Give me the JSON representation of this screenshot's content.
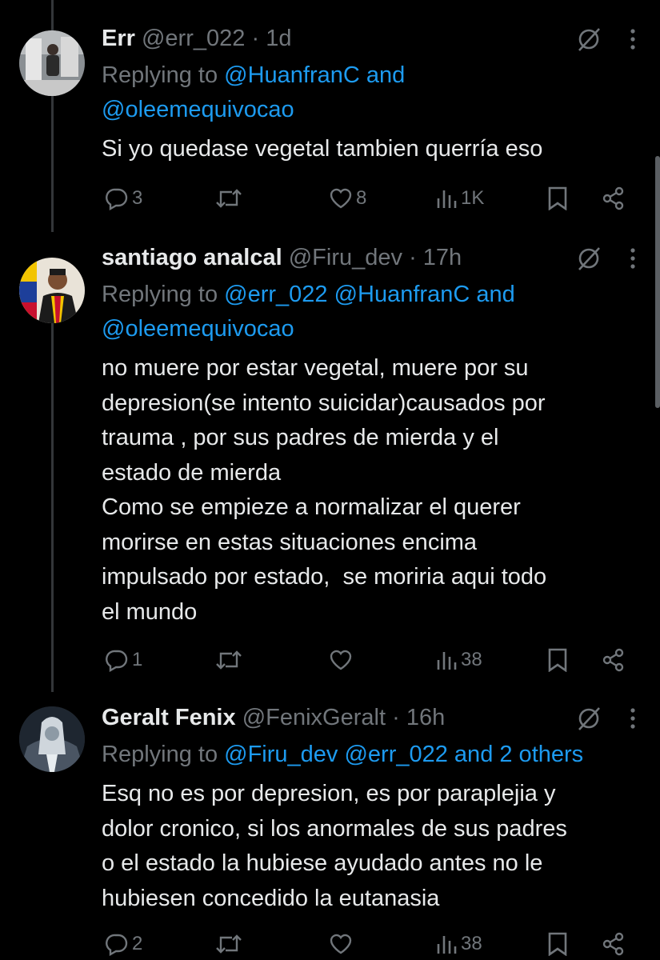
{
  "tweets": [
    {
      "name": "Err",
      "handle": "@err_022",
      "sep": "·",
      "time": "1d",
      "reply_prefix": "Replying to",
      "reply_line1": "@HuanfranC and",
      "reply_line2": "@oleemequivocao",
      "body": "Si yo quedase vegetal tambien querría eso",
      "replies": "3",
      "retweets": "",
      "likes": "8",
      "views": "1K",
      "avatar_icon": "avatar-photo"
    },
    {
      "name": "santiago analcal",
      "handle": "@Firu_dev",
      "sep": "·",
      "time": "17h",
      "reply_prefix": "Replying to",
      "reply_line1": "@err_022 @HuanfranC and",
      "reply_line2": "@oleemequivocao",
      "body": "no muere por estar vegetal, muere por su\ndepresion(se intento suicidar)causados por\ntrauma , por sus padres de mierda y el\nestado de mierda\nComo se empieze a normalizar el querer\nmorirse en estas situaciones encima\nimpulsado por estado,  se moriria aqui todo\nel mundo",
      "replies": "1",
      "retweets": "",
      "likes": "",
      "views": "38",
      "avatar_icon": "avatar-photo"
    },
    {
      "name": "Geralt Fenix",
      "handle": "@FenixGeralt",
      "sep": "·",
      "time": "16h",
      "reply_prefix": "Replying to",
      "reply_line1": "@Firu_dev @err_022 and 2 others",
      "body": "Esq no es por depresion, es por paraplejia y\ndolor cronico, si los anormales de sus padres\no el estado la hubiese ayudado antes no le\nhubiesen concedido la eutanasia",
      "replies": "2",
      "retweets": "",
      "likes": "",
      "views": "38",
      "avatar_icon": "avatar-photo"
    }
  ],
  "colors": {
    "background": "#000000",
    "text": "#e7e9ea",
    "muted": "#71767b",
    "link": "#1d9bf0",
    "thread_line": "#333639"
  },
  "icons": [
    "grok-icon",
    "more-icon",
    "reply-icon",
    "retweet-icon",
    "like-icon",
    "views-icon",
    "bookmark-icon",
    "share-icon"
  ]
}
